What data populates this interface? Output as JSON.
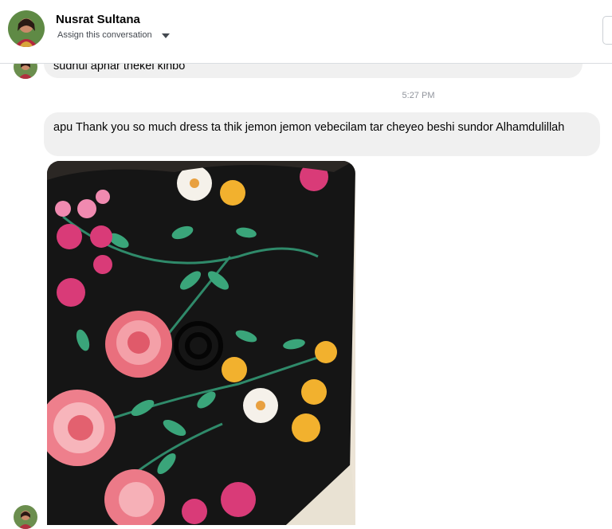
{
  "contact": {
    "name": "Nusrat Sultana",
    "assign_label": "Assign this conversation",
    "avatar_icon": "profile-photo"
  },
  "messages": [
    {
      "text": "sudhui apnar thekei kinbo",
      "partially_hidden": true
    },
    {
      "text": "apu Thank you so much dress ta thik jemon jemon vebecilam tar cheyeo beshi sundor Alhamdulillah"
    }
  ],
  "timestamp": "5:27 PM",
  "attachment": {
    "type": "photo",
    "subject": "black floral embroidered fabric"
  },
  "colors": {
    "bubble": "#f0f0f0",
    "timestamp": "#90949c",
    "divider": "#dadde1"
  }
}
